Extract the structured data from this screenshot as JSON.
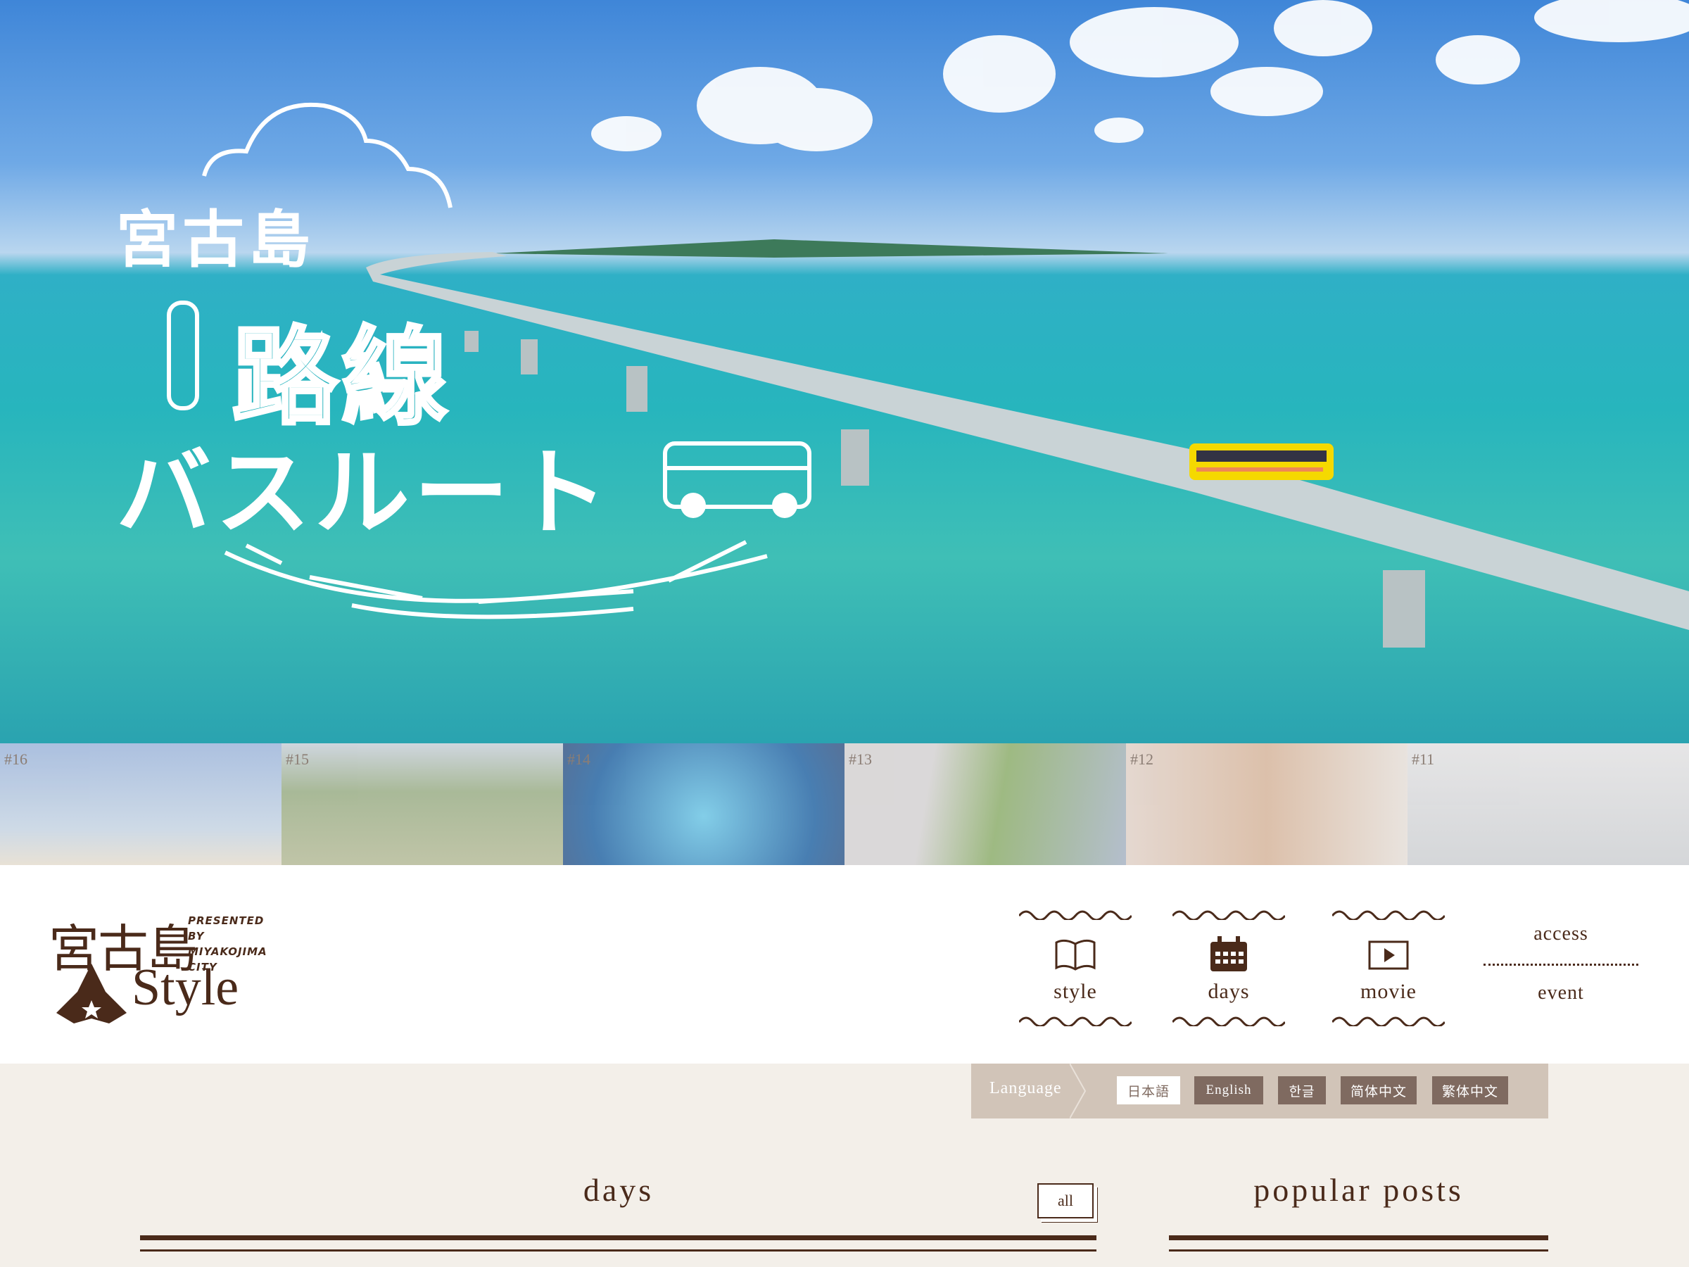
{
  "hero": {
    "title_line1": "宮古島",
    "title_line2": "路線",
    "title_line3": "バスルート"
  },
  "strip": {
    "items": [
      {
        "num": "#16"
      },
      {
        "num": "#15"
      },
      {
        "num": "#14"
      },
      {
        "num": "#13"
      },
      {
        "num": "#12"
      },
      {
        "num": "#11"
      }
    ]
  },
  "logo": {
    "kanji": "宮古島",
    "presented": "PRESENTED BY",
    "presented2": "MIYAKOJIMA",
    "presented3": "CITY",
    "style": "Style"
  },
  "nav": {
    "style": "style",
    "days": "days",
    "movie": "movie",
    "access": "access",
    "event": "event"
  },
  "language": {
    "label": "Language",
    "options": [
      "日本語",
      "English",
      "한글",
      "简体中文",
      "繁体中文"
    ],
    "selected": "日本語"
  },
  "sections": {
    "days": "days",
    "all": "all",
    "popular": "popular posts"
  }
}
